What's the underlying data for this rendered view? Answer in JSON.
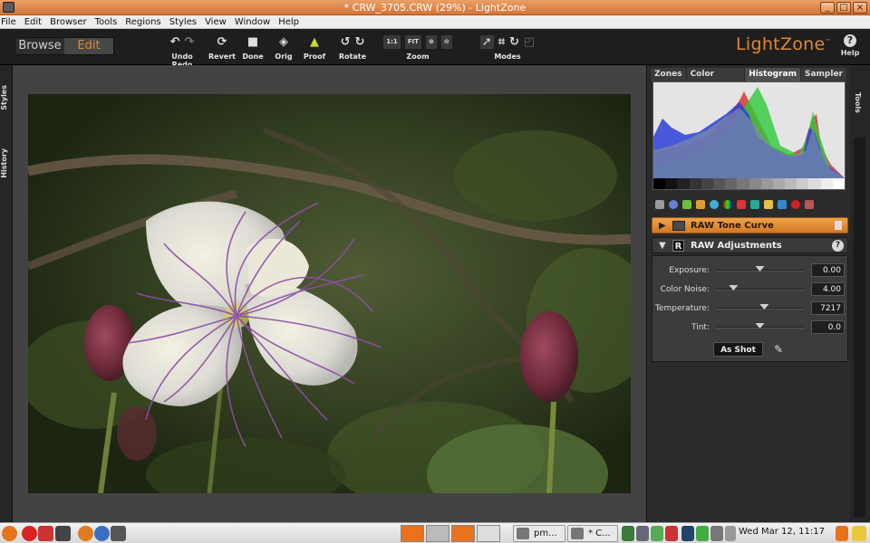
{
  "window": {
    "title": "* CRW_3705.CRW (29%) - LightZone",
    "controls": [
      "_",
      "□",
      "×"
    ]
  },
  "menu": [
    "File",
    "Edit",
    "Browser",
    "Tools",
    "Regions",
    "Styles",
    "View",
    "Window",
    "Help"
  ],
  "toolbar": {
    "mode_browse": "Browse",
    "mode_edit": "Edit",
    "undo_redo_label": "Undo Redo",
    "revert_label": "Revert",
    "done_label": "Done",
    "orig_label": "Orig",
    "proof_label": "Proof",
    "rotate_label": "Rotate",
    "zoom_label": "Zoom",
    "zoom_1_1": "1:1",
    "zoom_fit": "FIT",
    "modes_label": "Modes",
    "brand": "LightZone",
    "brand_tm": "™",
    "help_label": "Help",
    "help_glyph": "?"
  },
  "left_tabs": [
    "Styles",
    "History"
  ],
  "right_tab": "Tools",
  "panel": {
    "tabs": [
      "Zones",
      "Color Mask",
      "Histogram",
      "Sampler"
    ],
    "active_tab": "Histogram",
    "tone_curve_title": "RAW Tone Curve",
    "raw_adjust_title": "RAW Adjustments",
    "raw_badge": "R",
    "help_glyph": "?",
    "adjustments": [
      {
        "label": "Exposure:",
        "value": "0.00",
        "level": 0.5
      },
      {
        "label": "Color Noise:",
        "value": "4.00",
        "level": 0.2
      },
      {
        "label": "Temperature:",
        "value": "7217",
        "level": 0.55
      },
      {
        "label": "Tint:",
        "value": "0.0",
        "level": 0.5
      }
    ],
    "as_shot_label": "As Shot"
  },
  "taskbar": {
    "tasks": [
      "pm...",
      "* C..."
    ],
    "clock": "Wed Mar 12, 11:17"
  },
  "colors": {
    "accent": "#e1892f",
    "titlebar": "#d4743a",
    "panel_bg": "#2b2b2b"
  }
}
